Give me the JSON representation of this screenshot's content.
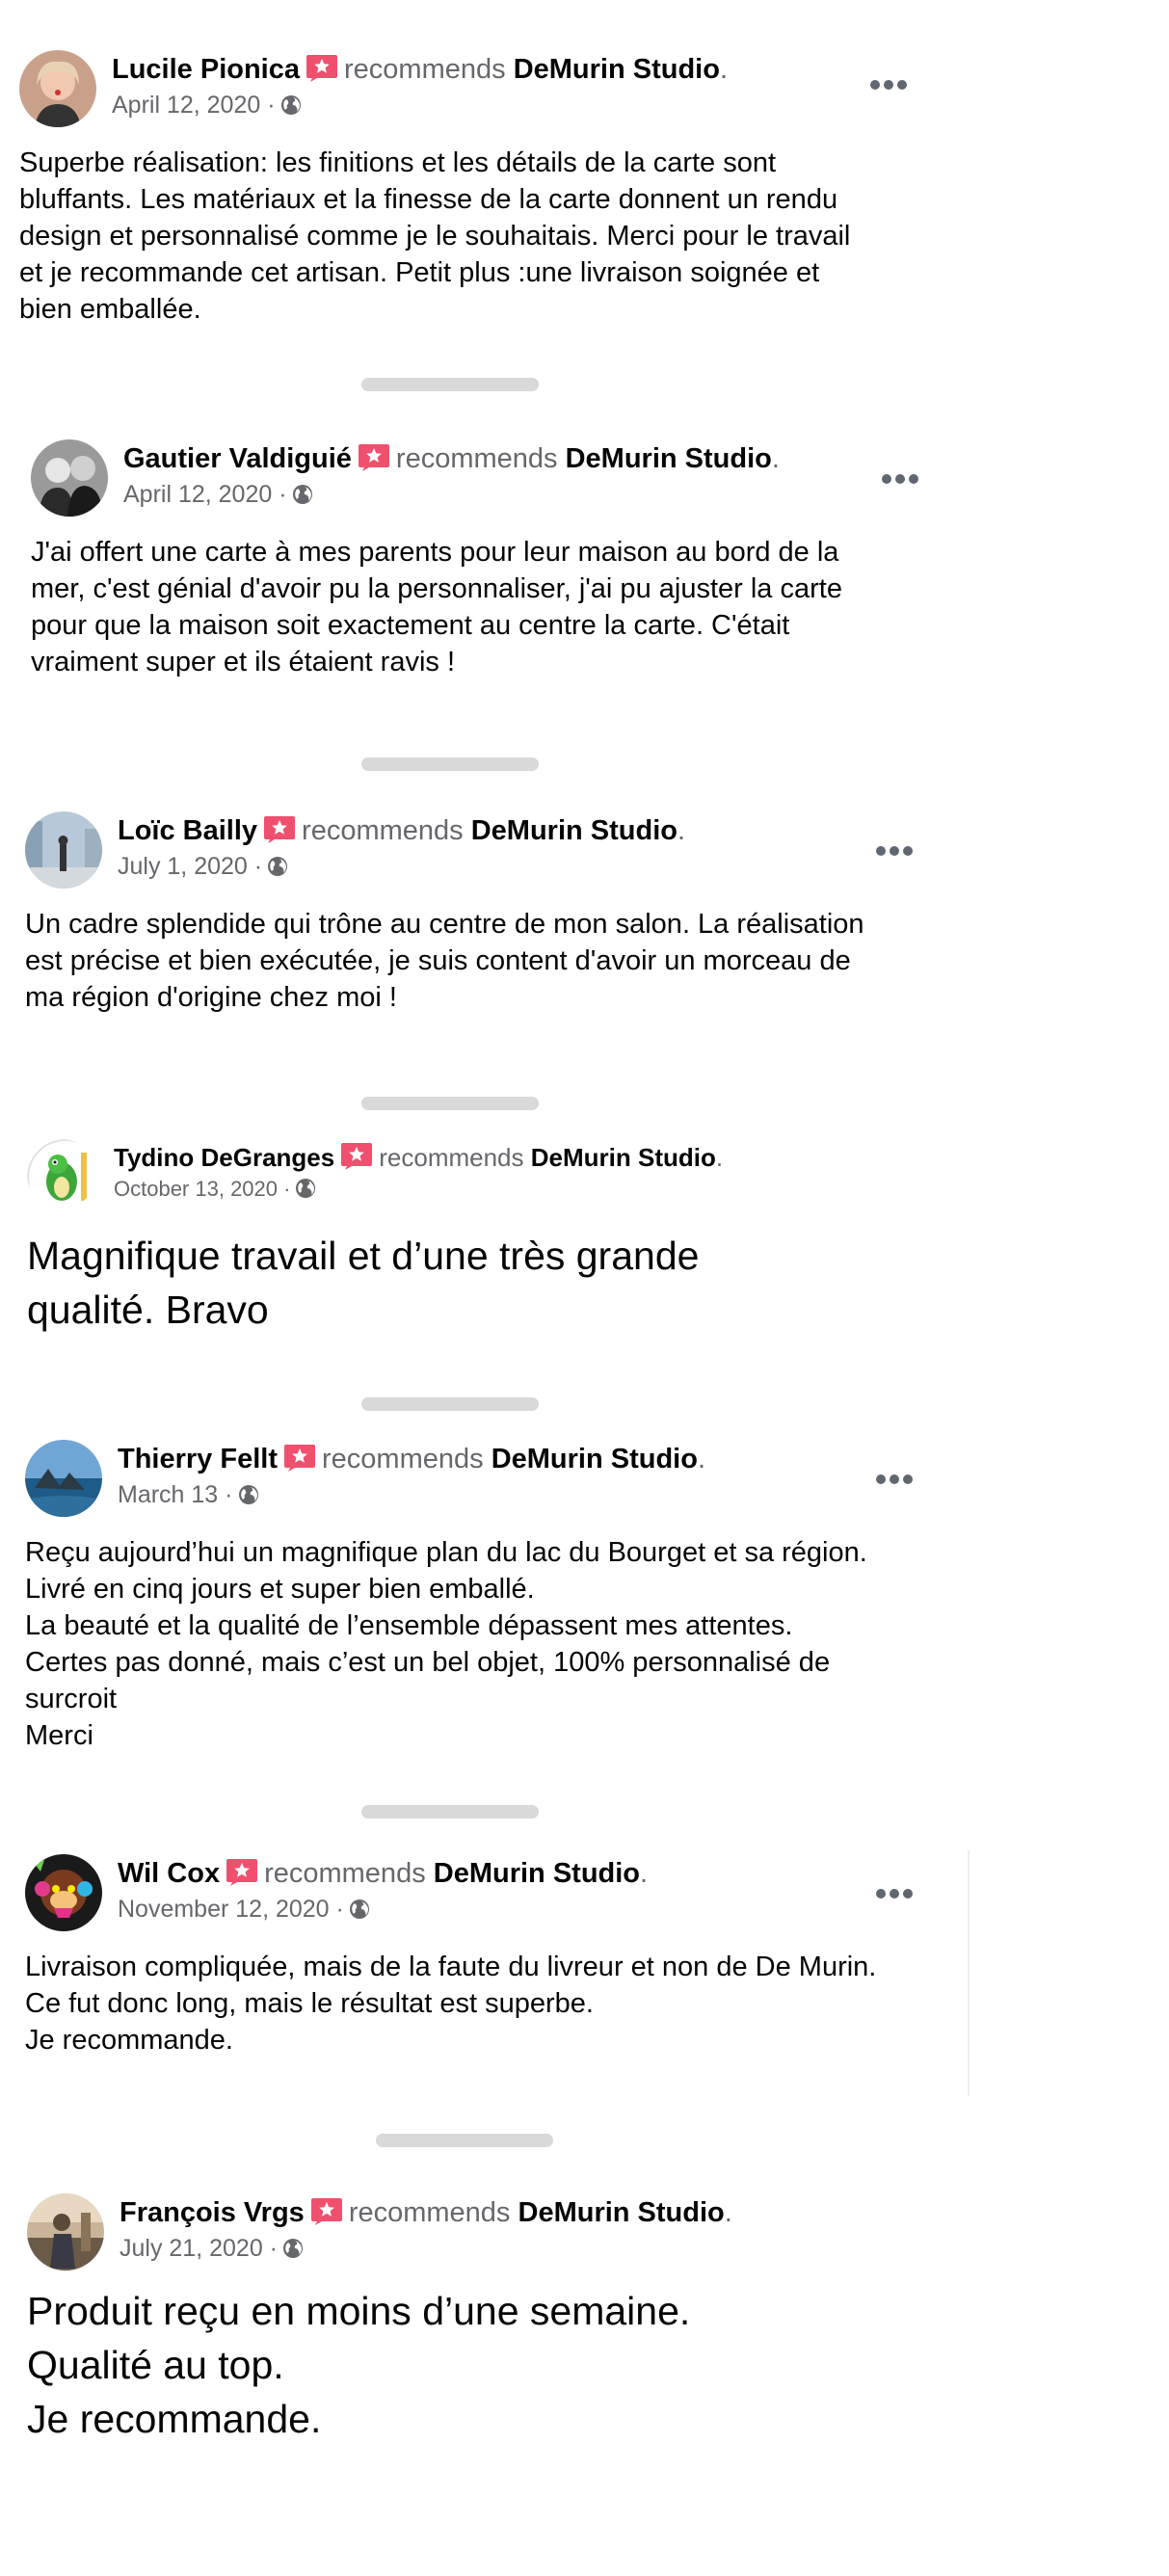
{
  "recommends_text": "recommends",
  "page_name": "DeMurin Studio",
  "period": ".",
  "date_separator": "·",
  "colors": {
    "recommend_badge": "#f0506e",
    "secondary_text": "#65676b",
    "separator": "#d9d9d9"
  },
  "reviews": [
    {
      "name": "Lucile Pionica",
      "date": "April 12, 2020",
      "text": "Superbe réalisation: les finitions et les  détails de la carte sont\nbluffants. Les matériaux et la finesse de la carte donnent un rendu\ndesign et personnalisé comme je le souhaitais. Merci pour le travail\net je recommande cet artisan. Petit plus :une livraison soignée et\nbien emballée.",
      "avatar_icon": "woman-portrait-avatar"
    },
    {
      "name": "Gautier Valdiguié",
      "date": "April 12, 2020",
      "text": "J'ai offert une carte à mes parents pour leur maison au bord de la\nmer, c'est génial d'avoir pu la personnaliser, j'ai pu ajuster la carte\npour que la maison soit exactement au centre la carte. C'était\nvraiment super et ils étaient ravis !",
      "avatar_icon": "two-men-bw-avatar"
    },
    {
      "name": "Loïc Bailly",
      "date": "July 1, 2020",
      "text": "Un cadre splendide qui trône au centre de mon salon. La réalisation\nest précise et bien exécutée, je suis content d'avoir un morceau de\nma région d'origine chez moi !",
      "avatar_icon": "city-square-avatar"
    },
    {
      "name": "Tydino DeGranges",
      "date": "October 13, 2020",
      "text": "Magnifique travail et d’une très grande\nqualité. Bravo",
      "avatar_icon": "green-dinosaur-avatar"
    },
    {
      "name": "Thierry Fellt",
      "date": "March 13",
      "text": "Reçu aujourd’hui un magnifique plan du lac du Bourget et sa région.\nLivré en cinq jours et super bien emballé.\nLa beauté et la qualité de l’ensemble dépassent mes attentes.\nCertes pas donné, mais c’est un bel objet, 100% personnalisé de\nsurcroit\nMerci",
      "avatar_icon": "seaside-rocks-avatar"
    },
    {
      "name": "Wil Cox",
      "date": "November 12, 2020",
      "text": "Livraison compliquée, mais de la faute du livreur et non de De Murin.\nCe fut donc long, mais le résultat est superbe.\nJe recommande.",
      "avatar_icon": "colorful-monkey-avatar"
    },
    {
      "name": "François Vrgs",
      "date": "July 21, 2020",
      "text": "Produit reçu en moins d’une semaine.\nQualité au top.\nJe recommande.",
      "avatar_icon": "person-outdoor-avatar"
    }
  ]
}
